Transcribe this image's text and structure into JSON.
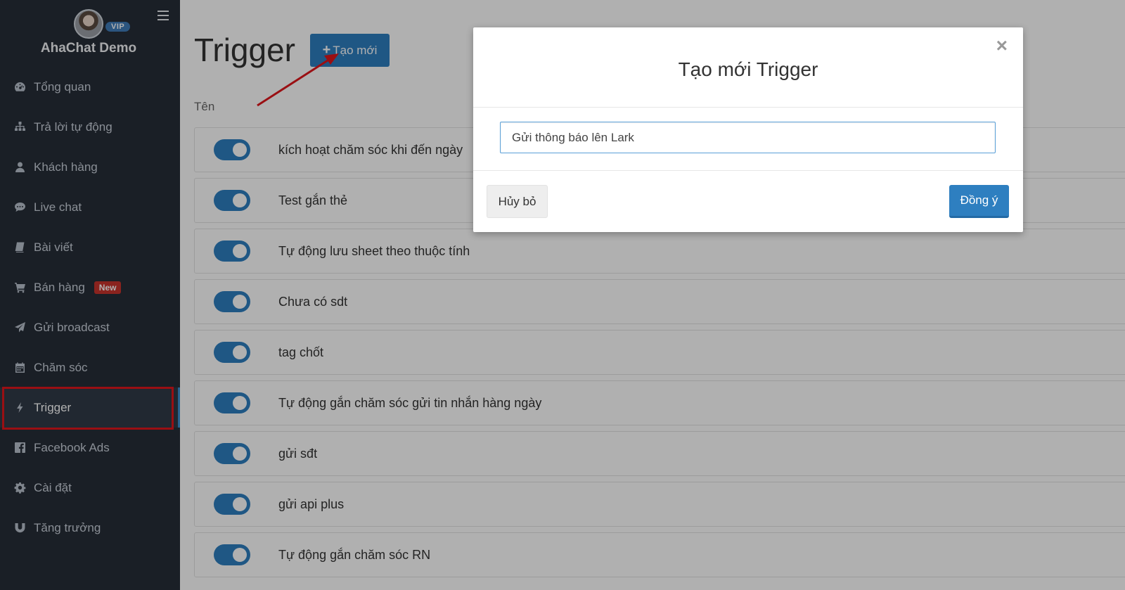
{
  "sidebar": {
    "vip_badge": "VIP",
    "brand_name": "AhaChat Demo",
    "items": [
      {
        "label": "Tổng quan",
        "icon": "dashboard-icon"
      },
      {
        "label": "Trả lời tự động",
        "icon": "sitemap-icon"
      },
      {
        "label": "Khách hàng",
        "icon": "user-icon"
      },
      {
        "label": "Live chat",
        "icon": "chat-icon"
      },
      {
        "label": "Bài viết",
        "icon": "book-icon"
      },
      {
        "label": "Bán hàng",
        "icon": "cart-icon",
        "badge": "New"
      },
      {
        "label": "Gửi broadcast",
        "icon": "paper-plane-icon"
      },
      {
        "label": "Chăm sóc",
        "icon": "calendar-icon"
      },
      {
        "label": "Trigger",
        "icon": "bolt-icon",
        "active": true
      },
      {
        "label": "Facebook Ads",
        "icon": "facebook-icon"
      },
      {
        "label": "Cài đặt",
        "icon": "gear-icon"
      },
      {
        "label": "Tăng trưởng",
        "icon": "magnet-icon"
      }
    ]
  },
  "main": {
    "title": "Trigger",
    "new_button": "Tạo mới",
    "column_header": "Tên",
    "triggers": [
      {
        "name": "kích hoạt chăm sóc khi đến ngày",
        "enabled": true
      },
      {
        "name": "Test gắn thẻ",
        "enabled": true
      },
      {
        "name": "Tự động lưu sheet theo thuộc tính",
        "enabled": true
      },
      {
        "name": "Chưa có sdt",
        "enabled": true
      },
      {
        "name": "tag chốt",
        "enabled": true
      },
      {
        "name": "Tự động gắn chăm sóc gửi tin nhắn hàng ngày",
        "enabled": true
      },
      {
        "name": "gửi sđt",
        "enabled": true
      },
      {
        "name": "gửi api plus",
        "enabled": true
      },
      {
        "name": "Tự động gắn chăm sóc RN",
        "enabled": true
      }
    ]
  },
  "modal": {
    "title": "Tạo mới Trigger",
    "close": "×",
    "input_value": "Gửi thông báo lên Lark",
    "cancel": "Hủy bỏ",
    "confirm": "Đồng ý"
  },
  "colors": {
    "sidebar_bg": "#262d37",
    "primary": "#2e7fc0",
    "annotation_red": "#e0161c",
    "badge_red": "#c9342c"
  }
}
